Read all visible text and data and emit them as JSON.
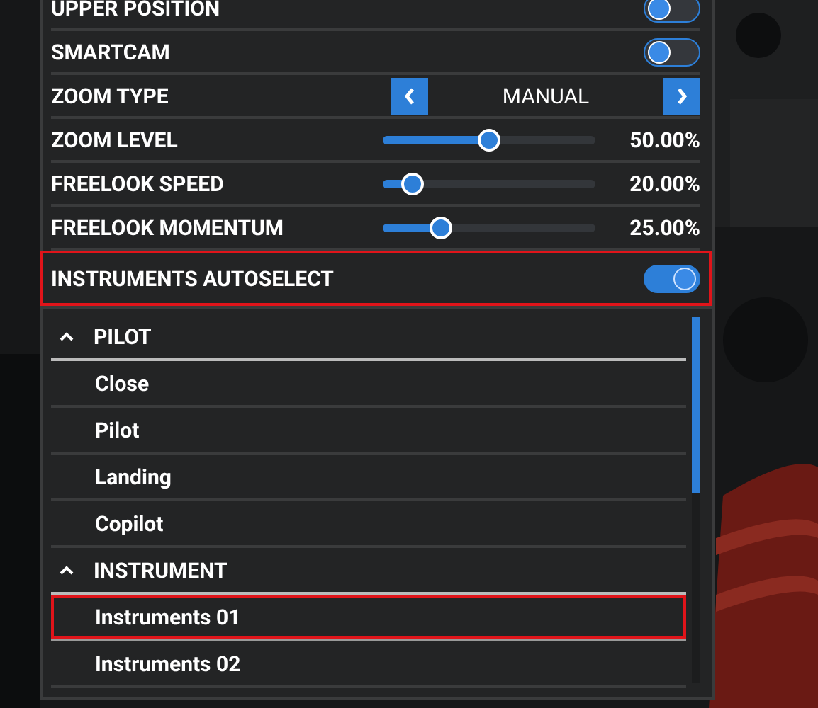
{
  "settings": [
    {
      "kind": "toggle",
      "label": "UPPER POSITION",
      "on": false,
      "highlighted": false
    },
    {
      "kind": "toggle",
      "label": "SMARTCAM",
      "on": false,
      "highlighted": false
    },
    {
      "kind": "selector",
      "label": "ZOOM TYPE",
      "value": "MANUAL",
      "highlighted": false
    },
    {
      "kind": "slider",
      "label": "ZOOM LEVEL",
      "level": 0.5,
      "reading": "50.00%",
      "highlighted": false
    },
    {
      "kind": "slider",
      "label": "FREELOOK SPEED",
      "level": 0.14,
      "reading": "20.00%",
      "highlighted": false
    },
    {
      "kind": "slider",
      "label": "FREELOOK MOMENTUM",
      "level": 0.27,
      "reading": "25.00%",
      "highlighted": false
    },
    {
      "kind": "toggle",
      "label": "INSTRUMENTS AUTOSELECT",
      "on": true,
      "highlighted": true
    }
  ],
  "camera_list": [
    {
      "title": "PILOT",
      "expanded": true,
      "children": [
        {
          "label": "Close",
          "highlighted": false
        },
        {
          "label": "Pilot",
          "highlighted": false
        },
        {
          "label": "Landing",
          "highlighted": false
        },
        {
          "label": "Copilot",
          "highlighted": false
        }
      ]
    },
    {
      "title": "INSTRUMENT",
      "expanded": true,
      "children": [
        {
          "label": "Instruments 01",
          "highlighted": true
        },
        {
          "label": "Instruments 02",
          "highlighted": false
        }
      ]
    }
  ]
}
